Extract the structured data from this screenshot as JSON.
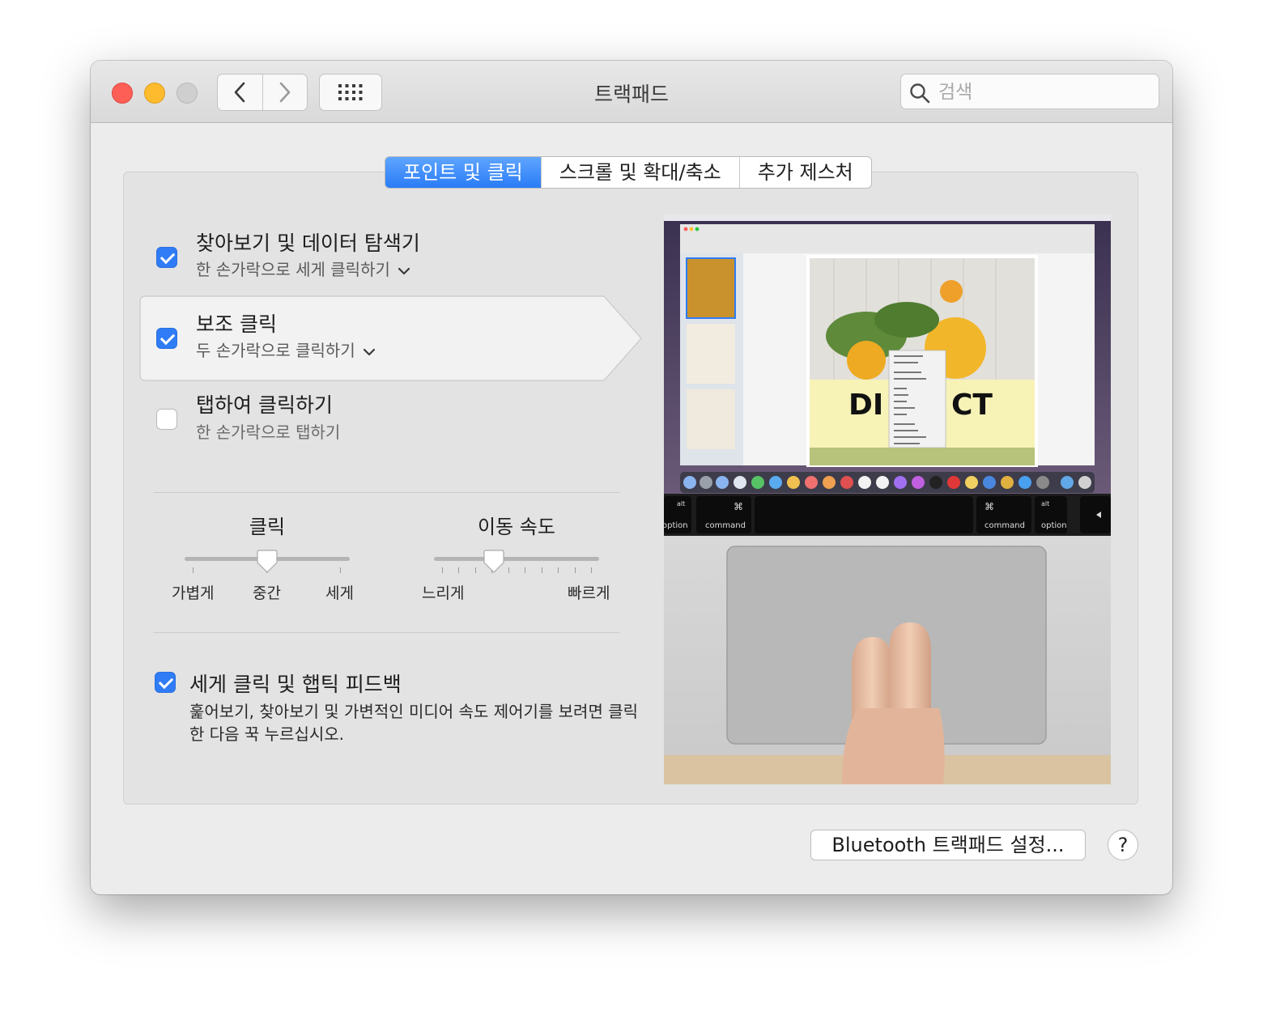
{
  "window": {
    "title": "트랙패드",
    "search_placeholder": "검색"
  },
  "tabs": [
    {
      "label": "포인트 및 클릭",
      "active": true
    },
    {
      "label": "스크롤 및 확대/축소",
      "active": false
    },
    {
      "label": "추가 제스처",
      "active": false
    }
  ],
  "options": [
    {
      "title": "찾아보기 및 데이터 탐색기",
      "subtitle": "한 손가락으로 세게 클릭하기",
      "checked": true,
      "has_menu": true
    },
    {
      "title": "보조 클릭",
      "subtitle": "두 손가락으로 클릭하기",
      "checked": true,
      "has_menu": true
    },
    {
      "title": "탭하여 클릭하기",
      "subtitle": "한 손가락으로 탭하기",
      "checked": false,
      "has_menu": false
    }
  ],
  "click_slider": {
    "label": "클릭",
    "ticks": [
      "가볍게",
      "중간",
      "세게"
    ],
    "value_index": 1
  },
  "speed_slider": {
    "label": "이동 속도",
    "min_label": "느리게",
    "max_label": "빠르게",
    "tick_count": 10,
    "value_fraction": 0.35
  },
  "haptic": {
    "title": "세게 클릭 및 햅틱 피드백",
    "description": "훑어보기, 찾아보기 및 가변적인 미디어 속도 제어기를 보려면 클릭한 다음 꾹 누르십시오.",
    "checked": true
  },
  "preview": {
    "keyboard": {
      "left_alt": "alt",
      "left_option": "option",
      "left_command_symbol": "⌘",
      "left_command": "command",
      "right_command_symbol": "⌘",
      "right_command": "command",
      "right_alt": "alt",
      "right_option": "option"
    },
    "screen_headline_left": "DI",
    "screen_headline_right": "CT"
  },
  "buttons": {
    "bluetooth": "Bluetooth 트랙패드 설정...",
    "help": "?"
  },
  "colors": {
    "accent": "#2f7cf6",
    "close": "#fd5f57",
    "minimize": "#febb2e"
  }
}
